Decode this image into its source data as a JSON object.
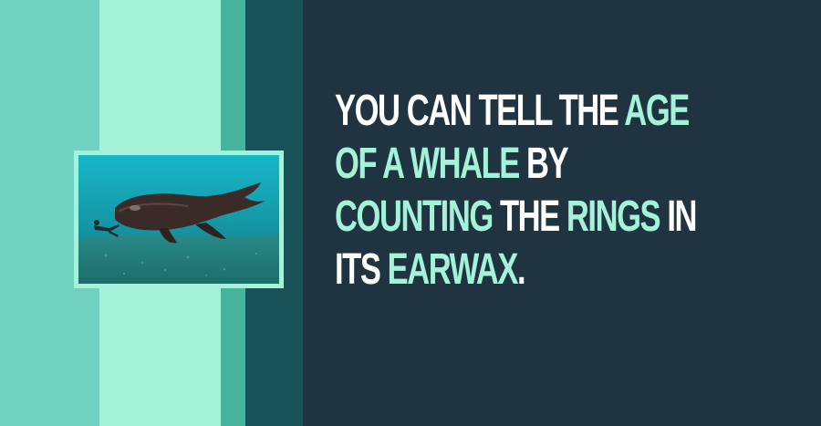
{
  "background": {
    "colors": {
      "dark": "#1f3341",
      "mint": "#a4f2d8",
      "teal": "#70d1c1",
      "deep_teal": "#1a525a"
    }
  },
  "photo": {
    "subject": "whale-underwater-with-diver"
  },
  "fact": {
    "lines": [
      [
        {
          "text": "YOU CAN TELL THE ",
          "hl": false
        },
        {
          "text": "AGE",
          "hl": true
        }
      ],
      [
        {
          "text": "OF A WHALE",
          "hl": true
        },
        {
          "text": " BY",
          "hl": false
        }
      ],
      [
        {
          "text": "COUNTING",
          "hl": true
        },
        {
          "text": " THE ",
          "hl": false
        },
        {
          "text": "RINGS",
          "hl": true
        },
        {
          "text": " IN",
          "hl": false
        }
      ],
      [
        {
          "text": "ITS ",
          "hl": false
        },
        {
          "text": "EARWAX",
          "hl": true
        },
        {
          "text": ".",
          "hl": false
        }
      ]
    ]
  }
}
